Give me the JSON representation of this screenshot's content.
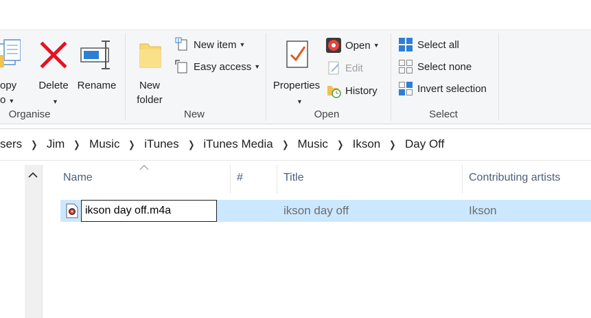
{
  "ribbon": {
    "organise": {
      "label": "Organise",
      "copy_to_line1": "opy",
      "copy_to_line2": "o",
      "delete_label": "Delete",
      "rename_label": "Rename"
    },
    "new": {
      "label": "New",
      "new_folder_line1": "New",
      "new_folder_line2": "folder",
      "new_item_label": "New item",
      "easy_access_label": "Easy access"
    },
    "open": {
      "label": "Open",
      "properties_label": "Properties",
      "open_label": "Open",
      "edit_label": "Edit",
      "history_label": "History"
    },
    "select": {
      "label": "Select",
      "select_all_label": "Select all",
      "select_none_label": "Select none",
      "invert_selection_label": "Invert selection"
    }
  },
  "address": {
    "crumbs": [
      "sers",
      "Jim",
      "Music",
      "iTunes",
      "iTunes Media",
      "Music",
      "Ikson",
      "Day Off"
    ],
    "separator": "❯"
  },
  "columns": {
    "name": "Name",
    "number": "#",
    "title": "Title",
    "contributing_artists": "Contributing artists"
  },
  "files": [
    {
      "name_editing": "ikson day off.m4a",
      "title": "ikson day off",
      "artist": "Ikson"
    }
  ],
  "colors": {
    "selection": "#cce8ff",
    "accent": "#0078d7",
    "delete_red": "#e81123"
  }
}
